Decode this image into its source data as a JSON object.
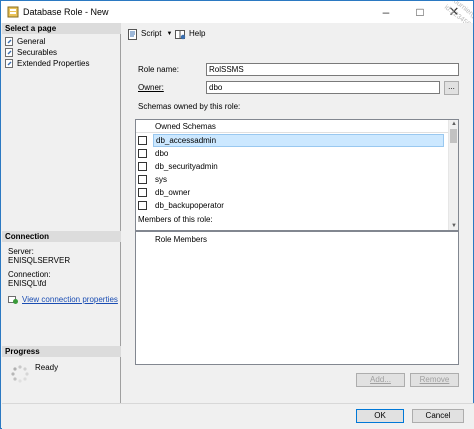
{
  "window": {
    "title": "Database Role - New"
  },
  "watermark": {
    "lines": [
      "Ce document est la propriété exclusive de",
      "pierre fournier(pierre.fou",
      "id:12345678"
    ]
  },
  "left_pane": {
    "select_page_heading": "Select a page",
    "pages": [
      {
        "label": "General",
        "icon": "wrench-page-icon"
      },
      {
        "label": "Securables",
        "icon": "wrench-page-icon"
      },
      {
        "label": "Extended Properties",
        "icon": "wrench-page-icon"
      }
    ],
    "connection_heading": "Connection",
    "server_label": "Server:",
    "server_value": "ENISQLSERVER",
    "connection_label": "Connection:",
    "connection_value": "ENISQL\\fd",
    "view_connection_link": "View connection properties",
    "progress_heading": "Progress",
    "progress_status": "Ready"
  },
  "toolbar": {
    "script_label": "Script",
    "help_label": "Help"
  },
  "form": {
    "role_name_label": "Role name:",
    "role_name_value": "RolSSMS",
    "owner_label": "Owner:",
    "owner_value": "dbo",
    "ellipsis_label": "...",
    "schemas_label": "Schemas owned by this role:",
    "schemas_header": "Owned Schemas",
    "schemas": [
      {
        "name": "db_accessadmin",
        "checked": false,
        "selected": true
      },
      {
        "name": "dbo",
        "checked": false,
        "selected": false
      },
      {
        "name": "db_securityadmin",
        "checked": false,
        "selected": false
      },
      {
        "name": "sys",
        "checked": false,
        "selected": false
      },
      {
        "name": "db_owner",
        "checked": false,
        "selected": false
      },
      {
        "name": "db_backupoperator",
        "checked": false,
        "selected": false
      }
    ],
    "members_label": "Members of this role:",
    "members_header": "Role Members",
    "add_label": "Add...",
    "remove_label": "Remove"
  },
  "footer": {
    "ok_label": "OK",
    "cancel_label": "Cancel"
  },
  "colors": {
    "accent": "#2b79c2",
    "link": "#1a4db3",
    "selection": "#cce8ff"
  }
}
